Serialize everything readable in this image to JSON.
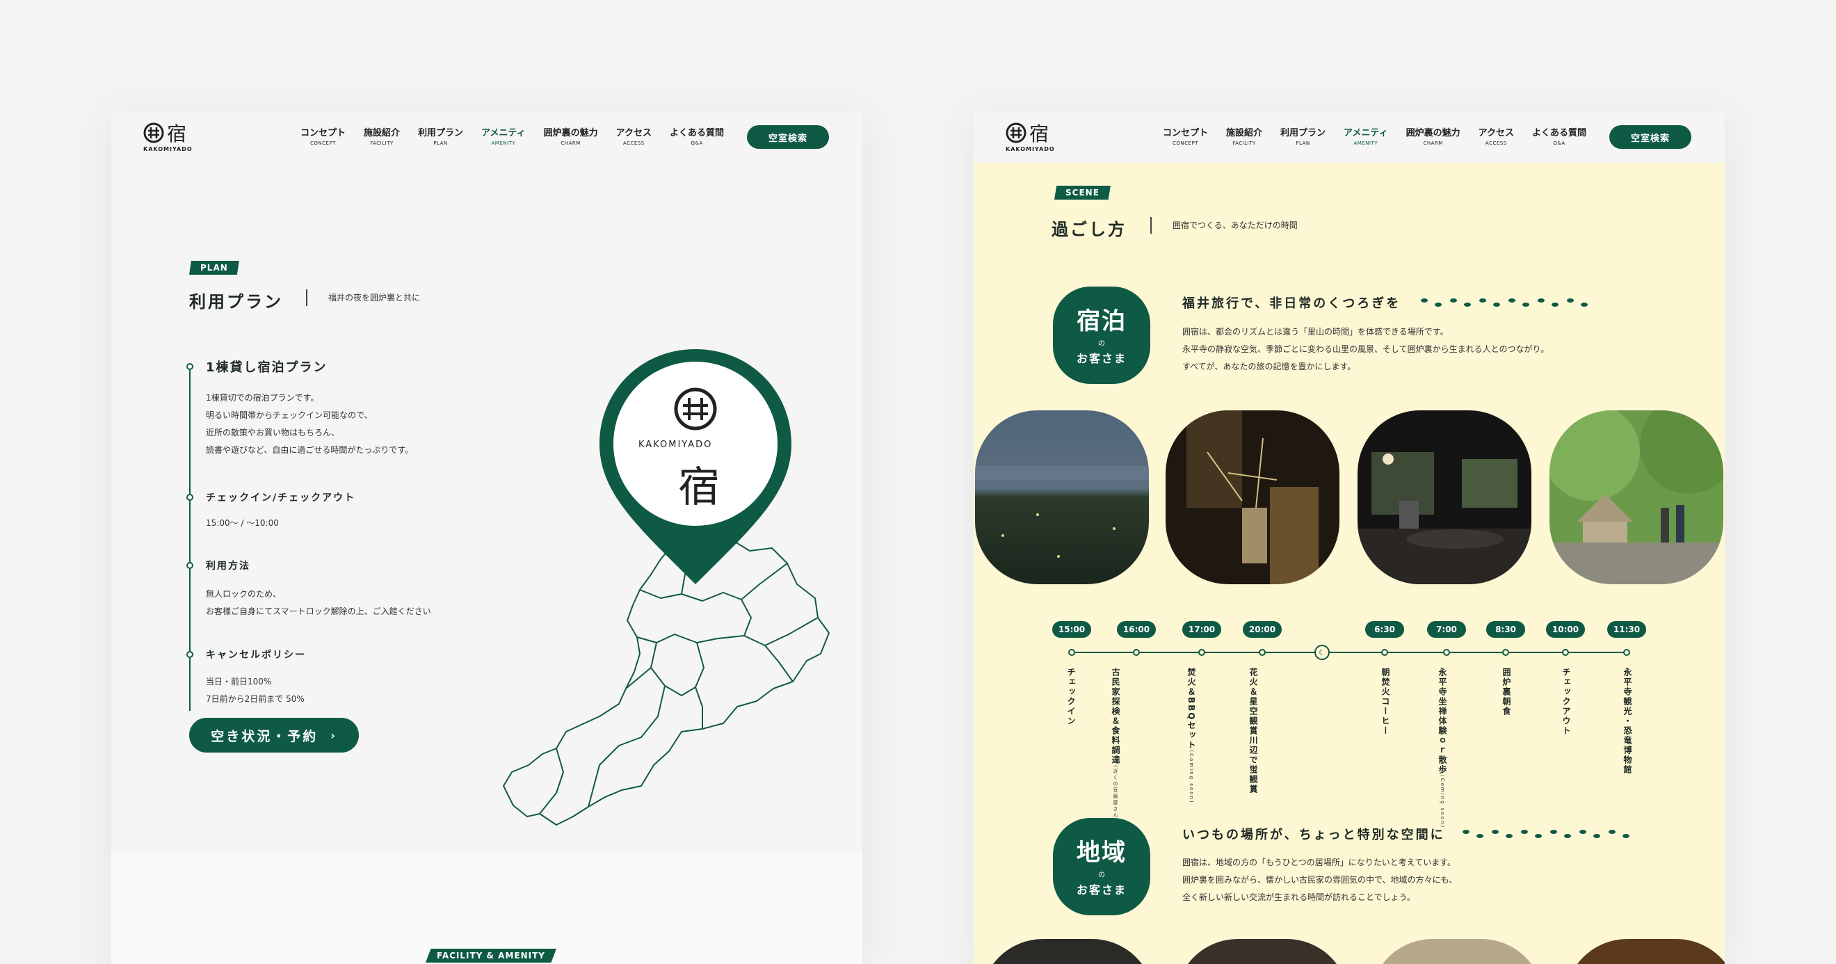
{
  "nav": {
    "logo_word": "KAKOMIYADO",
    "items": [
      {
        "ja": "コンセプト",
        "en": "CONCEPT"
      },
      {
        "ja": "施設紹介",
        "en": "FACILITY"
      },
      {
        "ja": "利用プラン",
        "en": "PLAN"
      },
      {
        "ja": "アメニティ",
        "en": "AMENITY"
      },
      {
        "ja": "囲炉裏の魅力",
        "en": "CHARM"
      },
      {
        "ja": "アクセス",
        "en": "ACCESS"
      },
      {
        "ja": "よくある質問",
        "en": "Q&A"
      }
    ],
    "search_label": "空室検索"
  },
  "plan": {
    "badge": "PLAN",
    "title": "利用プラン",
    "subtitle": "福井の夜を囲炉裏と共に",
    "h1": "1棟貸し宿泊プラン",
    "p1": [
      "1棟貸切での宿泊プランです。",
      "明るい時間帯からチェックイン可能なので、",
      "近所の散策やお買い物はもちろん、",
      "読書や遊びなど、自由に過ごせる時間がたっぷりです。"
    ],
    "h2": "チェックイン/チェックアウト",
    "p2": "15:00〜 / 〜10:00",
    "h3": "利用方法",
    "p3": [
      "無人ロックのため、",
      "お客様ご自身にてスマートロック解除の上、ご入館ください"
    ],
    "h4": "キャンセルポリシー",
    "p4": [
      "当日・前日100%",
      "7日前から2日前まで 50%"
    ],
    "cta": "空き状況・予約",
    "cta_arrow": "›",
    "pin_word": "KAKOMIYADO",
    "pin_kanji": "宿"
  },
  "facility_badge": "FACILITY & AMENITY",
  "scene": {
    "badge": "SCENE",
    "title": "過ごし方",
    "subtitle": "囲宿でつくる、あなただけの時間",
    "stay": {
      "big": "宿泊",
      "no": "の",
      "guest": "お客さま",
      "heading": "福井旅行で、非日常のくつろぎを",
      "lines": [
        "囲宿は、都会のリズムとは違う「里山の時間」を体感できる場所です。",
        "永平寺の静寂な空気、季節ごとに変わる山里の風景、そして囲炉裏から生まれる人とのつながり。",
        "すべてが、あなたの旅の記憶を豊かにします。"
      ]
    },
    "times": [
      "15:00",
      "16:00",
      "17:00",
      "20:00",
      "6:30",
      "7:00",
      "8:30",
      "10:00",
      "11:30"
    ],
    "activities": [
      {
        "main": "チェックイン",
        "note": ""
      },
      {
        "main": "古民家探検＆食料調達",
        "note": "(近くの豆腐屋さん・道の駅・福井名物「秋吉」など)"
      },
      {
        "main": "焚火＆BBQセット",
        "note": "(Coming soon)"
      },
      {
        "main": "花火＆星空観賞",
        "note": "川辺で蛍観賞"
      },
      {
        "main": "朝焚火コーヒー",
        "note": ""
      },
      {
        "main": "永平寺坐禅体験ｏｒ散歩",
        "note": "(Coming soon)"
      },
      {
        "main": "囲炉裏朝食",
        "note": ""
      },
      {
        "main": "チェックアウト",
        "note": ""
      },
      {
        "main": "永平寺観光・恐竜博物館",
        "note": ""
      }
    ],
    "local": {
      "big": "地域",
      "no": "の",
      "guest": "お客さま",
      "heading": "いつもの場所が、ちょっと特別な空間に",
      "lines": [
        "囲宿は、地域の方の「もうひとつの居場所」になりたいと考えています。",
        "囲炉裏を囲みながら、懐かしい古民家の雰囲気の中で、地域の方々にも、",
        "全く新しい新しい交流が生まれる時間が訪れることでしょう。"
      ]
    }
  },
  "colors": {
    "accent": "#0f5a45",
    "cream": "#fef7d4",
    "background": "#f3f3f3"
  },
  "icons": [
    "logo-icon",
    "footprints-icon",
    "moon-icon",
    "map-pin-icon",
    "chevron-right-icon"
  ]
}
